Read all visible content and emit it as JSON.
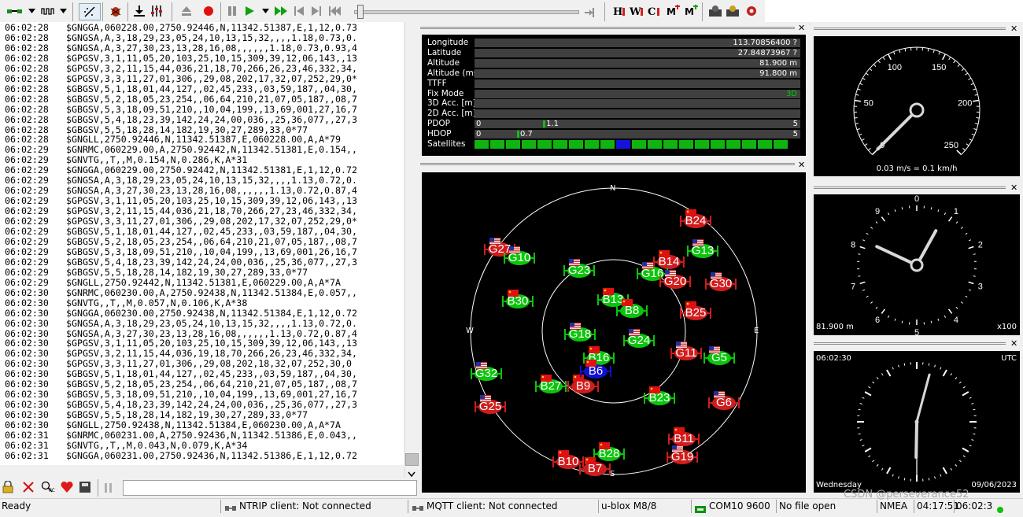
{
  "toolbar": {
    "icons": [
      "connection-icon",
      "dropdown-icon",
      "baud-icon",
      "dropdown-icon",
      "autobaud-icon",
      "debug-icon",
      "receive-icon",
      "settings-icon",
      "eject-icon",
      "record-icon",
      "pause-icon",
      "play-icon",
      "dropdown-icon",
      "fast-forward-icon",
      "step-back-icon",
      "step-forward-icon",
      "rewind-icon",
      "slider",
      "end-icon",
      "text-h-icon",
      "text-w-icon",
      "text-c-icon",
      "msg-add-icon",
      "msg-remove-icon",
      "config-icon",
      "gear-icon",
      "gear-red-icon"
    ],
    "playback_position": 0.02
  },
  "log": {
    "lines": [
      {
        "t": "06:02:28",
        "m": "$GNGGA,060228.00,2750.92446,N,11342.51387,E,1,12,0.73"
      },
      {
        "t": "06:02:28",
        "m": "$GNGSA,A,3,18,29,23,05,24,10,13,15,32,,,,1.18,0.73,0."
      },
      {
        "t": "06:02:28",
        "m": "$GNGSA,A,3,27,30,23,13,28,16,08,,,,,,1.18,0.73,0.93,4"
      },
      {
        "t": "06:02:28",
        "m": "$GPGSV,3,1,11,05,20,103,25,10,15,309,39,12,06,143,,13"
      },
      {
        "t": "06:02:28",
        "m": "$GPGSV,3,2,11,15,44,036,21,18,70,266,26,23,46,332,34,"
      },
      {
        "t": "06:02:28",
        "m": "$GPGSV,3,3,11,27,01,306,,29,08,202,17,32,07,252,29,0*"
      },
      {
        "t": "06:02:28",
        "m": "$GBGSV,5,1,18,01,44,127,,02,45,233,,03,59,187,,04,30,"
      },
      {
        "t": "06:02:28",
        "m": "$GBGSV,5,2,18,05,23,254,,06,64,210,21,07,05,187,,08,7"
      },
      {
        "t": "06:02:28",
        "m": "$GBGSV,5,3,18,09,51,210,,10,04,199,,13,69,001,27,16,7"
      },
      {
        "t": "06:02:28",
        "m": "$GBGSV,5,4,18,23,39,142,24,24,00,036,,25,36,077,,27,3"
      },
      {
        "t": "06:02:28",
        "m": "$GBGSV,5,5,18,28,14,182,19,30,27,289,33,0*77"
      },
      {
        "t": "06:02:28",
        "m": "$GNGLL,2750.92446,N,11342.51387,E,060228.00,A,A*79"
      },
      {
        "t": "06:02:29",
        "m": "$GNRMC,060229.00,A,2750.92442,N,11342.51381,E,0.154,,"
      },
      {
        "t": "06:02:29",
        "m": "$GNVTG,,T,,M,0.154,N,0.286,K,A*31"
      },
      {
        "t": "06:02:29",
        "m": "$GNGGA,060229.00,2750.92442,N,11342.51381,E,1,12,0.72"
      },
      {
        "t": "06:02:29",
        "m": "$GNGSA,A,3,18,29,23,05,24,10,13,15,32,,,,1.13,0.72,0."
      },
      {
        "t": "06:02:29",
        "m": "$GNGSA,A,3,27,30,23,13,28,16,08,,,,,,1.13,0.72,0.87,4"
      },
      {
        "t": "06:02:29",
        "m": "$GPGSV,3,1,11,05,20,103,25,10,15,309,39,12,06,143,,13"
      },
      {
        "t": "06:02:29",
        "m": "$GPGSV,3,2,11,15,44,036,21,18,70,266,27,23,46,332,34,"
      },
      {
        "t": "06:02:29",
        "m": "$GPGSV,3,3,11,27,01,306,,29,08,202,17,32,07,252,29,0*"
      },
      {
        "t": "06:02:29",
        "m": "$GBGSV,5,1,18,01,44,127,,02,45,233,,03,59,187,,04,30,"
      },
      {
        "t": "06:02:29",
        "m": "$GBGSV,5,2,18,05,23,254,,06,64,210,21,07,05,187,,08,7"
      },
      {
        "t": "06:02:29",
        "m": "$GBGSV,5,3,18,09,51,210,,10,04,199,,13,69,001,26,16,7"
      },
      {
        "t": "06:02:29",
        "m": "$GBGSV,5,4,18,23,39,142,24,24,00,036,,25,36,077,,27,3"
      },
      {
        "t": "06:02:29",
        "m": "$GBGSV,5,5,18,28,14,182,19,30,27,289,33,0*77"
      },
      {
        "t": "06:02:29",
        "m": "$GNGLL,2750.92442,N,11342.51381,E,060229.00,A,A*7A"
      },
      {
        "t": "06:02:30",
        "m": "$GNRMC,060230.00,A,2750.92438,N,11342.51384,E,0.057,,"
      },
      {
        "t": "06:02:30",
        "m": "$GNVTG,,T,,M,0.057,N,0.106,K,A*38"
      },
      {
        "t": "06:02:30",
        "m": "$GNGGA,060230.00,2750.92438,N,11342.51384,E,1,12,0.72"
      },
      {
        "t": "06:02:30",
        "m": "$GNGSA,A,3,18,29,23,05,24,10,13,15,32,,,,1.13,0.72,0."
      },
      {
        "t": "06:02:30",
        "m": "$GNGSA,A,3,27,30,23,13,28,16,08,,,,,,1.13,0.72,0.87,4"
      },
      {
        "t": "06:02:30",
        "m": "$GPGSV,3,1,11,05,20,103,25,10,15,309,39,12,06,143,,13"
      },
      {
        "t": "06:02:30",
        "m": "$GPGSV,3,2,11,15,44,036,19,18,70,266,26,23,46,332,34,"
      },
      {
        "t": "06:02:30",
        "m": "$GPGSV,3,3,11,27,01,306,,29,08,202,18,32,07,252,30,0"
      },
      {
        "t": "06:02:30",
        "m": "$GBGSV,5,1,18,01,44,127,,02,45,233,,03,59,187,,04,30,"
      },
      {
        "t": "06:02:30",
        "m": "$GBGSV,5,2,18,05,23,254,,06,64,210,21,07,05,187,,08,7"
      },
      {
        "t": "06:02:30",
        "m": "$GBGSV,5,3,18,09,51,210,,10,04,199,,13,69,001,27,16,7"
      },
      {
        "t": "06:02:30",
        "m": "$GBGSV,5,4,18,23,39,142,24,24,00,036,,25,36,077,,27,3"
      },
      {
        "t": "06:02:30",
        "m": "$GBGSV,5,5,18,28,14,182,19,30,27,289,33,0*77"
      },
      {
        "t": "06:02:30",
        "m": "$GNGLL,2750.92438,N,11342.51384,E,060230.00,A,A*7A"
      },
      {
        "t": "06:02:31",
        "m": "$GNRMC,060231.00,A,2750.92436,N,11342.51386,E,0.043,,"
      },
      {
        "t": "06:02:31",
        "m": "$GNVTG,,T,,M,0.043,N,0.079,K,A*34"
      },
      {
        "t": "06:02:31",
        "m": "$GNGGA,060231.00,2750.92436,N,11342.51386,E,1,12,0.72"
      }
    ]
  },
  "data_view": {
    "rows": [
      {
        "label": "Longitude",
        "value": "113.70856400 ?"
      },
      {
        "label": "Latitude",
        "value": "27.84873967 ?"
      },
      {
        "label": "Altitude",
        "value": "81.900 m"
      },
      {
        "label": "Altitude (msl)",
        "value": "91.800 m"
      },
      {
        "label": "TTFF",
        "value": ""
      },
      {
        "label": "Fix Mode",
        "value": "3D"
      },
      {
        "label": "3D Acc. [m]",
        "value": ""
      },
      {
        "label": "2D Acc. [m]",
        "value": ""
      }
    ],
    "pdop": {
      "label": "PDOP",
      "min": "0",
      "max": "5",
      "value": "1.1",
      "fraction": 0.22
    },
    "hdop": {
      "label": "HDOP",
      "min": "0",
      "max": "5",
      "value": "0.7",
      "fraction": 0.14
    },
    "satellites": {
      "label": "Satellites",
      "segments": [
        "green",
        "green",
        "green",
        "green",
        "green",
        "green",
        "green",
        "green",
        "green",
        "blue",
        "green",
        "green",
        "green",
        "green",
        "green",
        "green",
        "green",
        "green",
        "green",
        "green"
      ]
    },
    "accent": "#00cc00"
  },
  "sky": {
    "cardinals": {
      "n": "N",
      "s": "S",
      "e": "E",
      "w": "W"
    },
    "colors": {
      "used": "#0bc50b",
      "unused": "#d01c1c",
      "sbas": "#1010d0"
    },
    "satellites": [
      {
        "id": "G27",
        "state": "unused",
        "flag": "us"
      },
      {
        "id": "G10",
        "state": "used",
        "flag": "us"
      },
      {
        "id": "G23",
        "state": "used",
        "flag": "us"
      },
      {
        "id": "B24",
        "state": "unused",
        "flag": "cn"
      },
      {
        "id": "G13",
        "state": "used",
        "flag": "us"
      },
      {
        "id": "B14",
        "state": "unused",
        "flag": "cn"
      },
      {
        "id": "G16",
        "state": "used",
        "flag": "us"
      },
      {
        "id": "G20",
        "state": "unused",
        "flag": "us"
      },
      {
        "id": "G30",
        "state": "unused",
        "flag": "us"
      },
      {
        "id": "B30",
        "state": "used",
        "flag": "cn"
      },
      {
        "id": "B13",
        "state": "used",
        "flag": "cn"
      },
      {
        "id": "B8",
        "state": "used",
        "flag": "cn"
      },
      {
        "id": "B25",
        "state": "unused",
        "flag": "cn"
      },
      {
        "id": "G18",
        "state": "used",
        "flag": "us"
      },
      {
        "id": "G24",
        "state": "used",
        "flag": "us"
      },
      {
        "id": "B16",
        "state": "used",
        "flag": "cn"
      },
      {
        "id": "G11",
        "state": "unused",
        "flag": "us"
      },
      {
        "id": "G5",
        "state": "used",
        "flag": "us"
      },
      {
        "id": "G32",
        "state": "used",
        "flag": "us"
      },
      {
        "id": "B27",
        "state": "used",
        "flag": "cn"
      },
      {
        "id": "B9",
        "state": "unused",
        "flag": "cn"
      },
      {
        "id": "B6",
        "state": "sbas",
        "flag": "cn"
      },
      {
        "id": "B23",
        "state": "used",
        "flag": "cn"
      },
      {
        "id": "G6",
        "state": "unused",
        "flag": "us"
      },
      {
        "id": "G25",
        "state": "unused",
        "flag": "us"
      },
      {
        "id": "B11",
        "state": "unused",
        "flag": "cn"
      },
      {
        "id": "G19",
        "state": "unused",
        "flag": "us"
      },
      {
        "id": "B28",
        "state": "used",
        "flag": "cn"
      },
      {
        "id": "B10",
        "state": "unused",
        "flag": "cn"
      },
      {
        "id": "B7",
        "state": "unused",
        "flag": "cn"
      }
    ]
  },
  "speed_gauge": {
    "ticks": [
      "0",
      "50",
      "100",
      "150",
      "200",
      "250"
    ],
    "caption": "0.03 m/s = 0.1 km/h",
    "value_kmh": 0.1
  },
  "altitude_gauge": {
    "ticks": [
      "0",
      "1",
      "2",
      "3",
      "4",
      "5",
      "6",
      "7",
      "8",
      "9"
    ],
    "left": "81.900 m",
    "right": "x100"
  },
  "clock": {
    "time": "06:02:30",
    "zone": "UTC",
    "day": "Wednesday",
    "date": "09/06/2023"
  },
  "status": {
    "ready": "Ready",
    "ntrip": "NTRIP client: Not connected",
    "mqtt": "MQTT client: Not connected",
    "receiver": "u-blox M8/8",
    "port": "COM10 9600",
    "file": "No file open",
    "protocol": "NMEA",
    "elapsed": "04:17:51",
    "clock": "06:02:3",
    "watermark": "CSDN @perseverance52"
  }
}
